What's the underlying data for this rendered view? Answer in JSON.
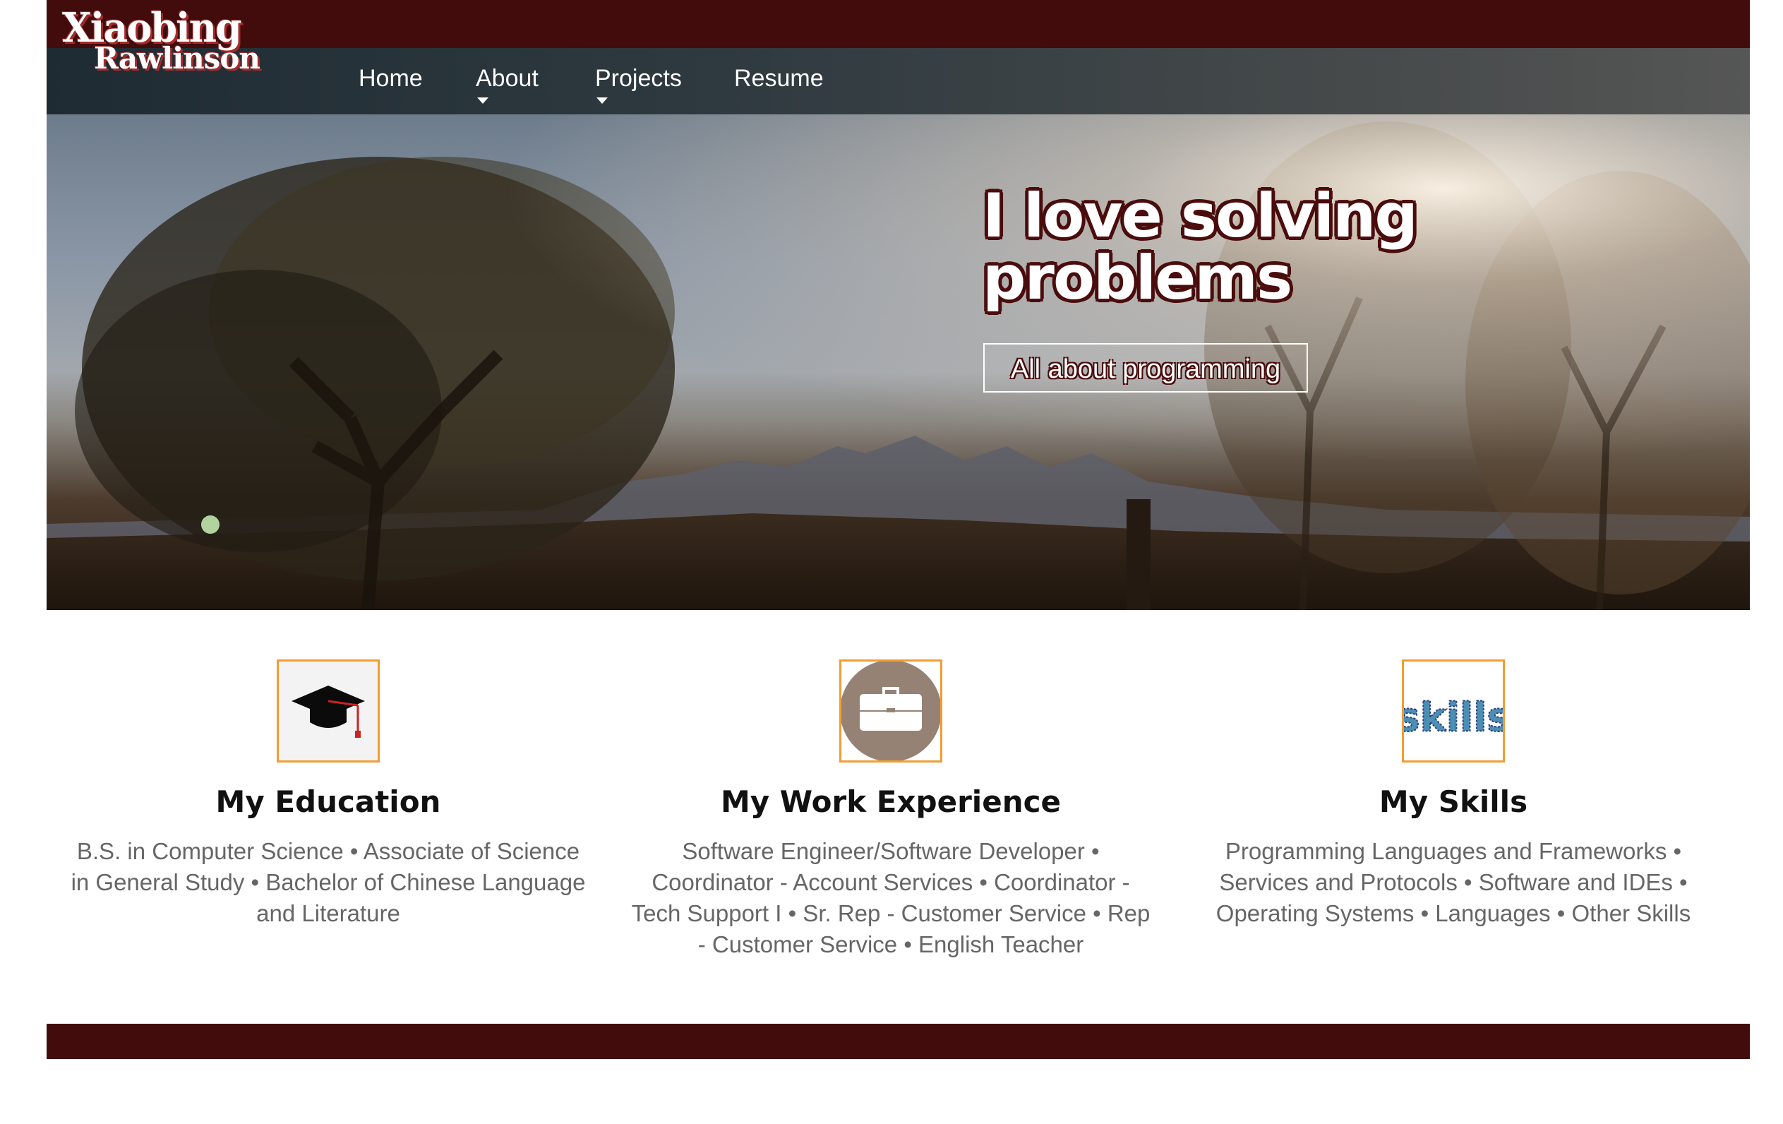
{
  "logo": {
    "line1": "Xiaobing",
    "line2": "Rawlinson"
  },
  "nav": {
    "items": [
      {
        "label": "Home",
        "has_dropdown": false
      },
      {
        "label": "About",
        "has_dropdown": true
      },
      {
        "label": "Projects",
        "has_dropdown": true
      },
      {
        "label": "Resume",
        "has_dropdown": false
      }
    ]
  },
  "hero": {
    "title": "I love solving problems",
    "button_label": "All about programming"
  },
  "features": [
    {
      "icon": "graduation-cap-icon",
      "title": "My Education",
      "text": "B.S. in Computer Science • Associate of Science in General Study • Bachelor of Chinese Language and Literature"
    },
    {
      "icon": "briefcase-icon",
      "title": "My Work Experience",
      "text": "Software Engineer/Software Developer • Coordinator - Account Services • Coordinator - Tech Support I • Sr. Rep - Customer Service • Rep - Customer Service • English Teacher"
    },
    {
      "icon": "skills-word-icon",
      "icon_text": "skills",
      "title": "My Skills",
      "text": "Programming Languages and Frameworks • Services and Protocols • Software and IDEs • Operating Systems • Languages • Other Skills"
    }
  ],
  "colors": {
    "brand": "#420c0c",
    "accent": "#f39c32",
    "text_muted": "#666666"
  }
}
